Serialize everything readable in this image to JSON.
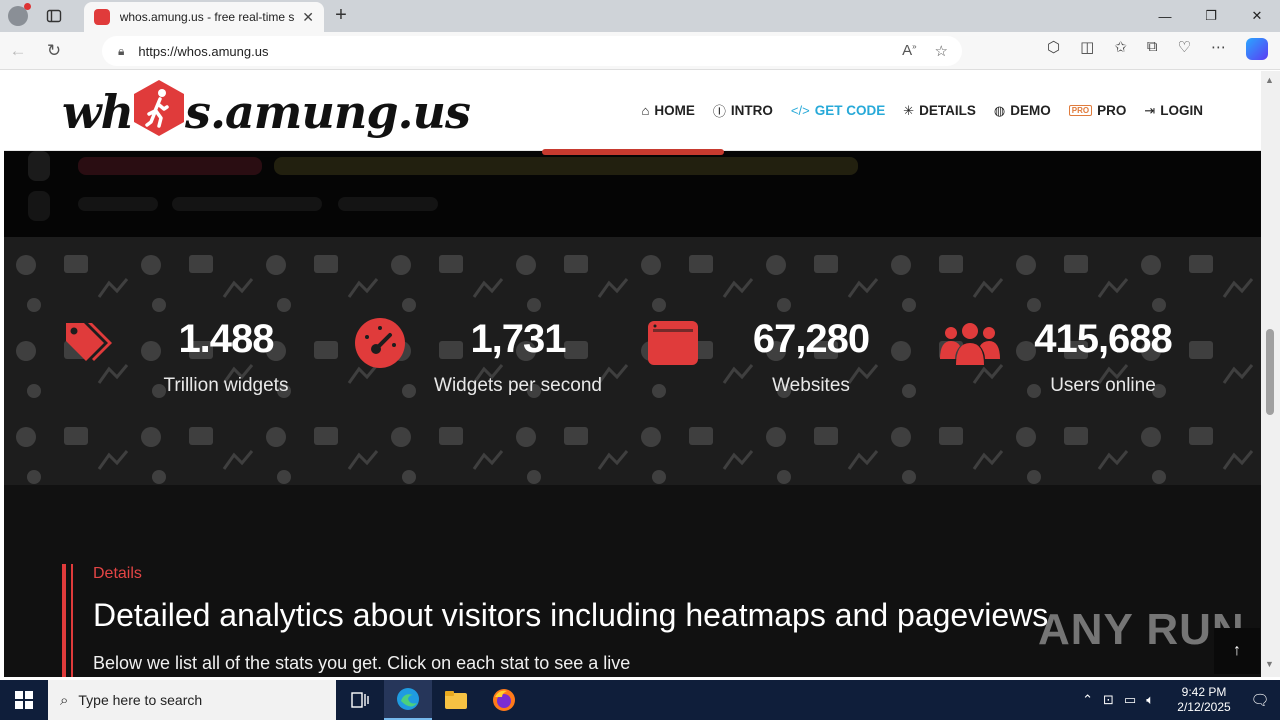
{
  "browser": {
    "tab_title": "whos.amung.us - free real-time s",
    "tab_close": "✕",
    "new_tab": "+",
    "url": "https://whos.amung.us",
    "window_min": "—",
    "window_restore": "❐",
    "window_close": "✕"
  },
  "site": {
    "logo_left": "wh",
    "logo_right": "s.amung.us",
    "nav": [
      {
        "icon": "⌂",
        "label": "HOME"
      },
      {
        "icon": "ⓘ",
        "label": "INTRO"
      },
      {
        "icon": "</>",
        "label": "GET CODE"
      },
      {
        "icon": "✳",
        "label": "DETAILS"
      },
      {
        "icon": "◍",
        "label": "DEMO"
      },
      {
        "icon": "PRO",
        "label": "PRO"
      },
      {
        "icon": "⇥",
        "label": "LOGIN"
      }
    ]
  },
  "stats": [
    {
      "value": "1.488",
      "label": "Trillion widgets",
      "icon": "tags-icon"
    },
    {
      "value": "1,731",
      "label": "Widgets per second",
      "icon": "gauge-icon"
    },
    {
      "value": "67,280",
      "label": "Websites",
      "icon": "browser-window-icon"
    },
    {
      "value": "415,688",
      "label": "Users online",
      "icon": "users-icon"
    }
  ],
  "details": {
    "kicker": "Details",
    "heading": "Detailed analytics about visitors including heatmaps and pageviews",
    "sub": "Below we list all of the stats you get. Click on each stat to see a live"
  },
  "watermark": "ANY RUN",
  "to_top": "↑",
  "taskbar": {
    "search_placeholder": "Type here to search",
    "time": "9:42 PM",
    "date": "2/12/2025"
  },
  "colors": {
    "accent_red": "#e03b3b",
    "nav_active": "#27a9d8",
    "stats_bg": "#1d1d1d"
  }
}
